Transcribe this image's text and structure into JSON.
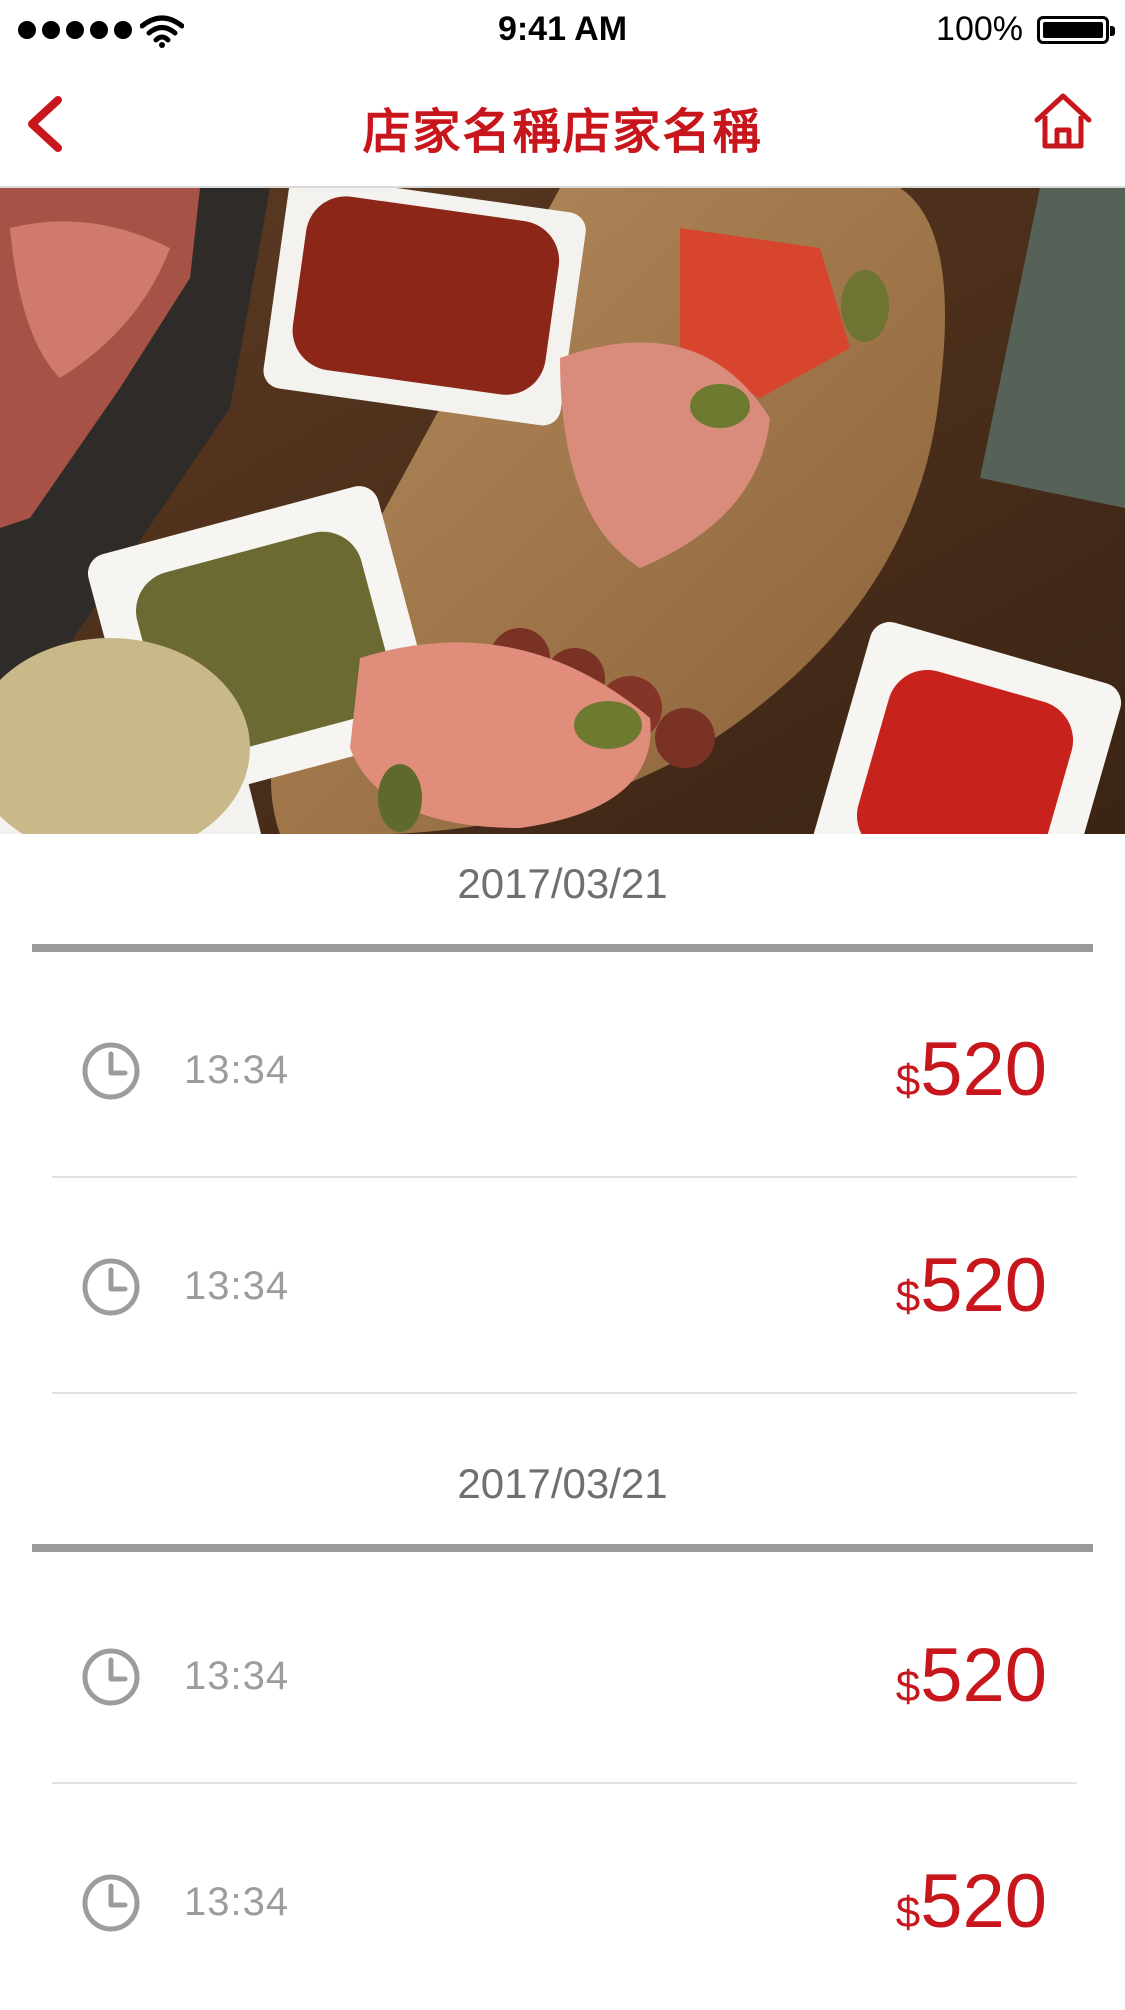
{
  "status_bar": {
    "time": "9:41 AM",
    "battery": "100%"
  },
  "nav": {
    "title": "店家名稱店家名稱",
    "back_icon": "chevron-left-icon",
    "home_icon": "home-icon"
  },
  "hero_image": {
    "subject": "charcuterie-board-photo"
  },
  "colors": {
    "accent": "#c8161d",
    "muted": "#9c9c9c",
    "rule": "#9a9a9a"
  },
  "groups": [
    {
      "date": "2017/03/21",
      "records": [
        {
          "time": "13:34",
          "currency": "$",
          "amount": "520"
        },
        {
          "time": "13:34",
          "currency": "$",
          "amount": "520"
        }
      ]
    },
    {
      "date": "2017/03/21",
      "records": [
        {
          "time": "13:34",
          "currency": "$",
          "amount": "520"
        },
        {
          "time": "13:34",
          "currency": "$",
          "amount": "520"
        }
      ]
    }
  ]
}
